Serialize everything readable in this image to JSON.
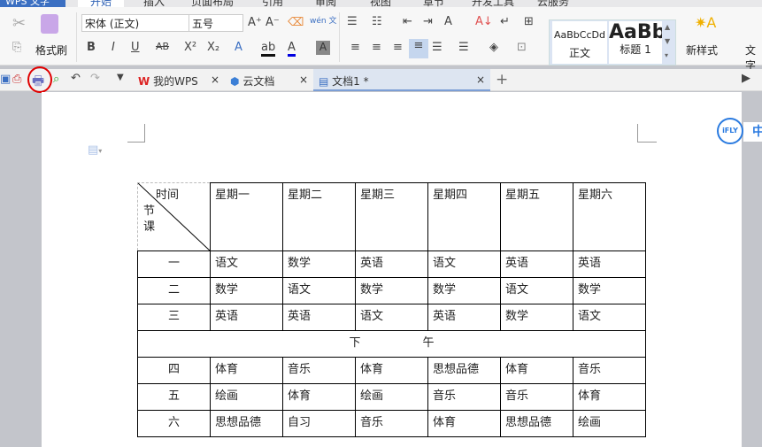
{
  "menubar": {
    "app": "WPS 文字",
    "tabs": [
      "开始",
      "插入",
      "页面布局",
      "引用",
      "审阅",
      "视图",
      "章节",
      "开发工具",
      "云服务"
    ],
    "active": "开始"
  },
  "ribbon": {
    "font_name": "宋体 (正文)",
    "font_size": "五号",
    "format_painter": "格式刷",
    "phonetic": "wén 文",
    "styles": [
      {
        "preview": "AaBbCcDd",
        "label": "正文"
      },
      {
        "preview": "AaBb",
        "label": "标题 1"
      }
    ],
    "new_style": "新样式",
    "text_tools": "文字"
  },
  "tabbar": {
    "tabs": [
      {
        "label": "我的WPS"
      },
      {
        "label": "云文档"
      },
      {
        "label": "文档1 *",
        "active": true
      }
    ]
  },
  "ifly": {
    "logo": "iFLY",
    "label": "中"
  },
  "table": {
    "corner": {
      "top": "时间",
      "left": [
        "节",
        "课"
      ]
    },
    "header": [
      "星期一",
      "星期二",
      "星期三",
      "星期四",
      "星期五",
      "星期六"
    ],
    "morning": [
      {
        "period": "一",
        "classes": [
          "语文",
          "数学",
          "英语",
          "语文",
          "英语",
          "英语"
        ]
      },
      {
        "period": "二",
        "classes": [
          "数学",
          "语文",
          "数学",
          "数学",
          "语文",
          "数学"
        ]
      },
      {
        "period": "三",
        "classes": [
          "英语",
          "英语",
          "语文",
          "英语",
          "数学",
          "语文"
        ]
      }
    ],
    "break_label": [
      "下",
      "午"
    ],
    "afternoon": [
      {
        "period": "四",
        "classes": [
          "体育",
          "音乐",
          "体育",
          "思想品德",
          "体育",
          "音乐"
        ]
      },
      {
        "period": "五",
        "classes": [
          "绘画",
          "体育",
          "绘画",
          "音乐",
          "音乐",
          "体育"
        ]
      },
      {
        "period": "六",
        "classes": [
          "思想品德",
          "自习",
          "音乐",
          "体育",
          "思想品德",
          "绘画"
        ]
      }
    ]
  },
  "colors": {
    "accent": "#2b5fb4",
    "highlight_circle": "#e00000"
  }
}
